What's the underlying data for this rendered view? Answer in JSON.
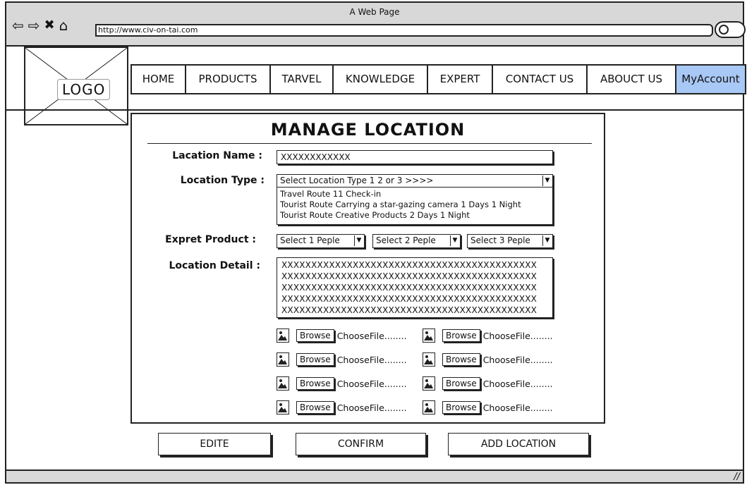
{
  "browser": {
    "window_title": "A Web Page",
    "url": "http://www.civ-on-tai.com"
  },
  "logo": {
    "text": "LOGO"
  },
  "menu": {
    "items": [
      {
        "label": "HOME"
      },
      {
        "label": "PRODUCTS"
      },
      {
        "label": "TARVEL"
      },
      {
        "label": "KNOWLEDGE"
      },
      {
        "label": "EXPERT"
      },
      {
        "label": "CONTACT US"
      },
      {
        "label": "ABOUCT US"
      },
      {
        "label": "MyAccount",
        "active": true
      }
    ],
    "active_color": "#a8c8f5"
  },
  "form": {
    "title": "MANAGE LOCATION",
    "location_name": {
      "label": "Lacation Name :",
      "value": "XXXXXXXXXXXX"
    },
    "location_type": {
      "label": "Location Type :",
      "selected": "Select Location Type 1  2 or 3 >>>>",
      "options": [
        "Travel Route 11 Check-in",
        "Tourist Route Carrying a star-gazing camera 1 Days 1 Night",
        "Tourist Route Creative Products 2 Days 1 Night"
      ]
    },
    "expert_product": {
      "label": "Expret Product :",
      "selects": [
        "Select 1 Peple",
        "Select 2 Peple",
        "Select 3 Peple"
      ]
    },
    "location_detail": {
      "label": "Location Detail :",
      "lines": [
        "XXXXXXXXXXXXXXXXXXXXXXXXXXXXXXXXXXXXXXXXXXX",
        "XXXXXXXXXXXXXXXXXXXXXXXXXXXXXXXXXXXXXXXXXXX",
        "XXXXXXXXXXXXXXXXXXXXXXXXXXXXXXXXXXXXXXXXXXX",
        "XXXXXXXXXXXXXXXXXXXXXXXXXXXXXXXXXXXXXXXXXXX",
        "XXXXXXXXXXXXXXXXXXXXXXXXXXXXXXXXXXXXXXXXXXX"
      ]
    },
    "files": {
      "browse_label": "Browse",
      "choose_label": "ChooseFile........"
    }
  },
  "actions": {
    "edit": "EDITE",
    "confirm": "CONFIRM",
    "add": "ADD LOCATION"
  }
}
